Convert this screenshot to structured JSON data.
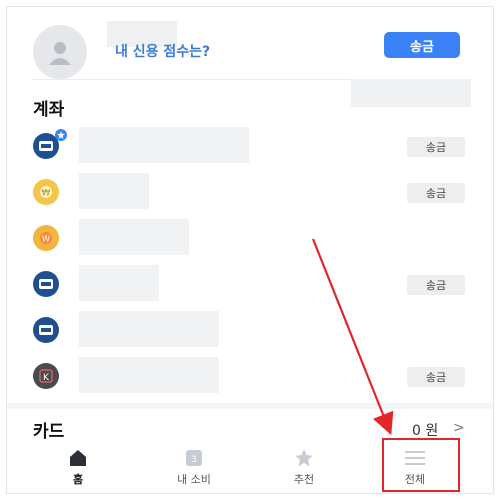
{
  "header": {
    "credit_link": "내 신용 점수는?",
    "send_button": "송금"
  },
  "accounts": {
    "title": "계좌",
    "rows": [
      {
        "icon": "bank-blue-icon",
        "send_label": "송금"
      },
      {
        "icon": "won-coin-icon",
        "send_label": "송금"
      },
      {
        "icon": "piggy-coin-icon",
        "send_label": ""
      },
      {
        "icon": "bank-blue-icon",
        "send_label": "송금"
      },
      {
        "icon": "bank-blue-icon",
        "send_label": ""
      },
      {
        "icon": "k-bank-icon",
        "send_label": "송금"
      }
    ]
  },
  "cards": {
    "title": "카드",
    "amount": "0 원",
    "chevron": ">"
  },
  "bottom_nav": {
    "items": [
      {
        "label": "홈",
        "icon": "home-icon"
      },
      {
        "label": "내 소비",
        "icon": "calendar-icon",
        "icon_text": "3"
      },
      {
        "label": "추천",
        "icon": "star-icon"
      },
      {
        "label": "전체",
        "icon": "menu-icon"
      }
    ]
  },
  "colors": {
    "accent": "#3b82f6",
    "highlight": "#e3262b"
  }
}
